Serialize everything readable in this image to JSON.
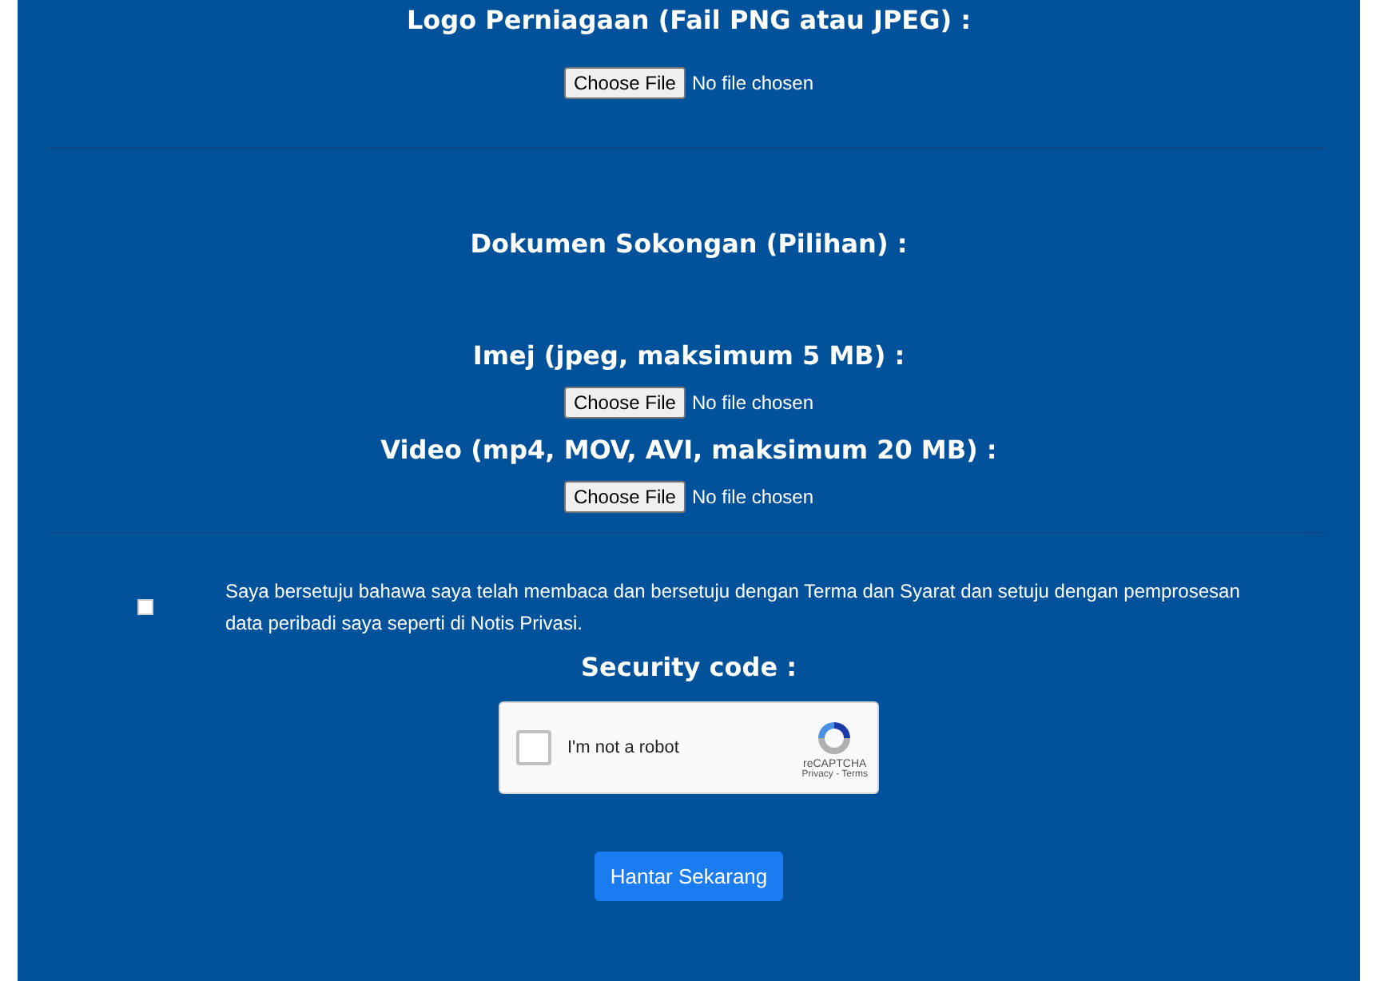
{
  "logo_field": {
    "label": "Logo Perniagaan (Fail PNG atau JPEG) :",
    "button": "Choose File",
    "status": "No file chosen"
  },
  "supporting_documents": {
    "heading": "Dokumen Sokongan (Pilihan) :",
    "fields": [
      {
        "label": "Imej (jpeg, maksimum 5 MB) :",
        "button": "Choose File",
        "status": "No file chosen"
      },
      {
        "label": "Video (mp4, MOV, AVI, maksimum 20 MB) :",
        "button": "Choose File",
        "status": "No file chosen"
      }
    ]
  },
  "consent": {
    "checked": false,
    "text": "Saya bersetuju bahawa saya telah membaca dan bersetuju dengan Terma dan Syarat dan setuju dengan pemprosesan data peribadi saya seperti di Notis Privasi."
  },
  "security": {
    "label": "Security code :",
    "captcha": {
      "checked": false,
      "text": "I'm not a robot",
      "brand": "reCAPTCHA",
      "links": "Privacy - Terms"
    }
  },
  "submit_button": "Hantar Sekarang"
}
